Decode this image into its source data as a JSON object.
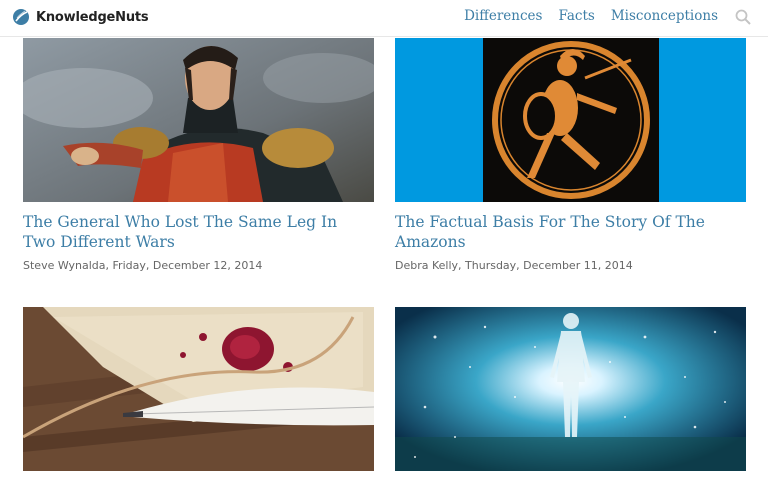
{
  "site": {
    "name": "KnowledgeNuts",
    "brand_color": "#3d7ea6"
  },
  "nav": {
    "items": [
      {
        "label": "Differences"
      },
      {
        "label": "Facts"
      },
      {
        "label": "Misconceptions"
      }
    ],
    "search_icon": "search-icon"
  },
  "articles": [
    {
      "title": "The General Who Lost The Same Leg In Two Different Wars",
      "author": "Steve Wynalda",
      "date": "Friday, December 12, 2014",
      "byline": "Steve Wynalda, Friday, December 12, 2014",
      "image": "painting-of-general-in-uniform"
    },
    {
      "title": "The Factual Basis For The Story Of The Amazons",
      "author": "Debra Kelly",
      "date": "Thursday, December 11, 2014",
      "byline": "Debra Kelly, Thursday, December 11, 2014",
      "image": "greek-pottery-warrior"
    },
    {
      "title": "",
      "byline": "",
      "image": "quill-and-wax-seal"
    },
    {
      "title": "",
      "byline": "",
      "image": "glowing-figure-in-space"
    }
  ]
}
